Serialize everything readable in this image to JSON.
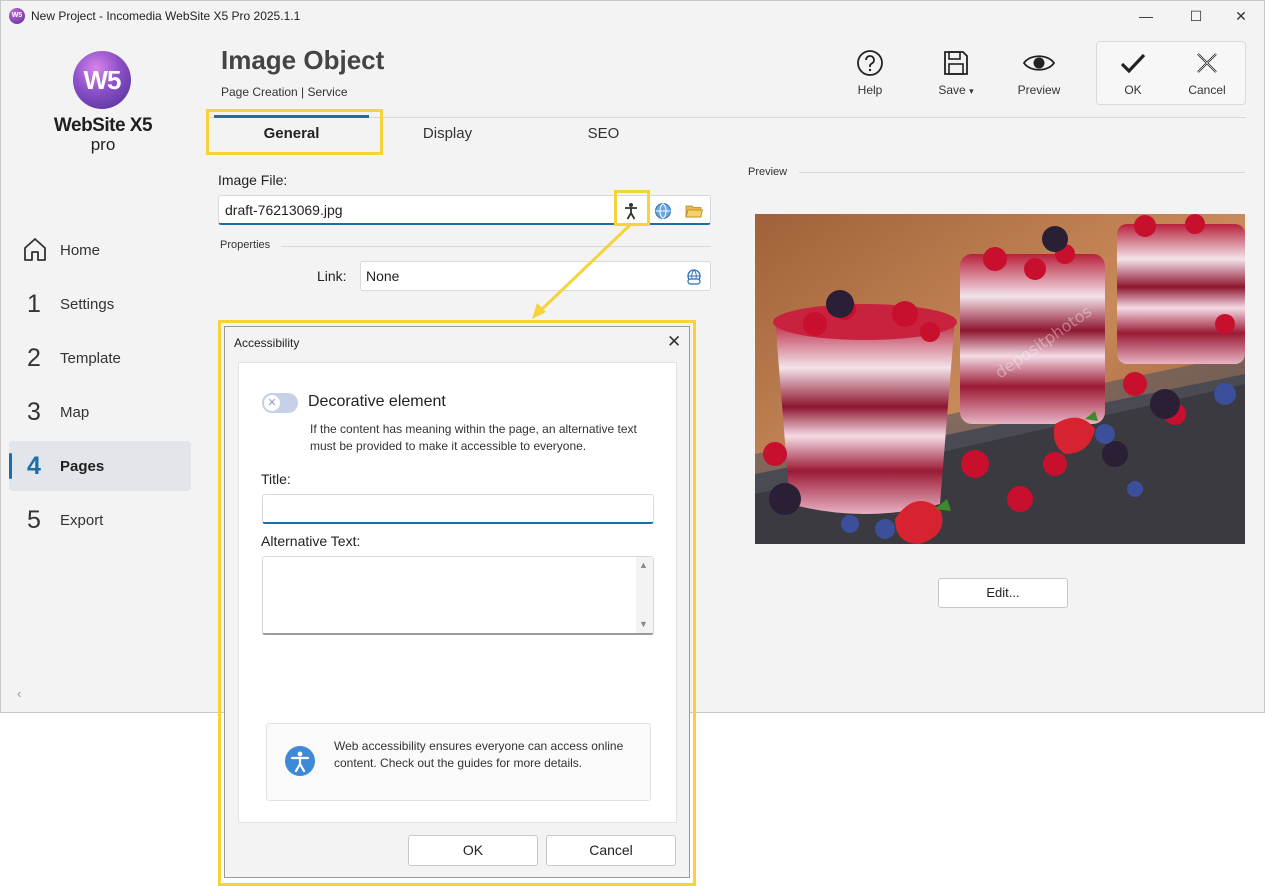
{
  "window": {
    "title": "New Project - Incomedia WebSite X5 Pro 2025.1.1",
    "app_icon_text": "W5",
    "minimize": "—",
    "maximize": "☐",
    "close": "✕"
  },
  "logo": {
    "mark": "W5",
    "brand": "WebSite X5",
    "edition": "pro"
  },
  "sidebar": {
    "items": [
      {
        "num": "",
        "label": "Home",
        "icon": "home-icon"
      },
      {
        "num": "1",
        "label": "Settings"
      },
      {
        "num": "2",
        "label": "Template"
      },
      {
        "num": "3",
        "label": "Map"
      },
      {
        "num": "4",
        "label": "Pages",
        "active": true
      },
      {
        "num": "5",
        "label": "Export"
      }
    ],
    "collapse": "‹"
  },
  "header": {
    "title": "Image Object",
    "breadcrumb": "Page Creation | Service",
    "toolbar": {
      "help": "Help",
      "save": "Save",
      "save_caret": "▾",
      "preview": "Preview",
      "ok": "OK",
      "cancel": "Cancel"
    }
  },
  "tabs": [
    {
      "label": "General",
      "active": true
    },
    {
      "label": "Display"
    },
    {
      "label": "SEO"
    }
  ],
  "form": {
    "image_file_label": "Image File:",
    "image_file_value": "draft-76213069.jpg",
    "properties_label": "Properties",
    "link_label": "Link:",
    "link_value": "None"
  },
  "preview": {
    "label": "Preview",
    "edit_button": "Edit...",
    "watermark": "depositphotos"
  },
  "dialog": {
    "title": "Accessibility",
    "close": "✕",
    "decorative_label": "Decorative element",
    "decorative_toggle": "off",
    "decorative_desc": "If the content has meaning within the page, an alternative text must be provided to make it accessible to everyone.",
    "title_label": "Title:",
    "title_value": "",
    "alt_label": "Alternative Text:",
    "alt_value": "",
    "info_text": "Web accessibility ensures everyone can access online content. Check out the guides for more details.",
    "ok": "OK",
    "cancel": "Cancel"
  },
  "colors": {
    "accent": "#1a6fa8",
    "highlight": "#f5d43a",
    "info_icon": "#3e8ad6"
  }
}
